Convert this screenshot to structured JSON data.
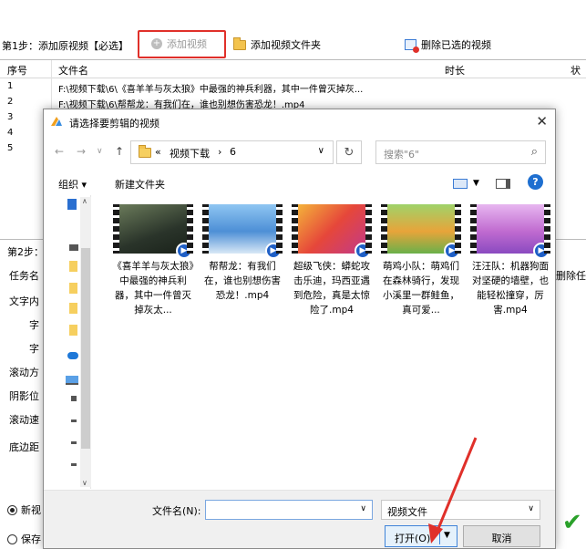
{
  "main": {
    "step1_label": "第1步：添加原视频【必选】",
    "toolbar": {
      "add_video": "添加视频",
      "add_folder": "添加视频文件夹",
      "delete_selected": "删除已选的视频"
    },
    "table": {
      "headers": [
        "序号",
        "文件名",
        "时长",
        "状"
      ],
      "rows": [
        {
          "n": "1",
          "file": "F:\\视频下载\\6\\《喜羊羊与灰太狼》中最强的神兵利器，其中一件曾灭掉灰..."
        },
        {
          "n": "2",
          "file": "F:\\视频下载\\6\\帮帮龙：有我们在，谁也别想伤害恐龙！.mp4"
        },
        {
          "n": "3",
          "file": ""
        },
        {
          "n": "4",
          "file": ""
        },
        {
          "n": "5",
          "file": ""
        }
      ]
    },
    "step2_label": "第2步：",
    "side_labels": [
      "任务名",
      "文字内",
      "字",
      "字",
      "滚动方",
      "阴影位",
      "滚动速",
      "底边距"
    ],
    "right_cut_label": "删除任",
    "radio_new": "新视",
    "radio_save": "保存"
  },
  "dialog": {
    "title": "请选择要剪辑的视频",
    "path": [
      "«",
      "视频下载",
      "›",
      "6"
    ],
    "search_placeholder": "搜索\"6\"",
    "organize": "组织 ▾",
    "new_folder": "新建文件夹",
    "files": [
      {
        "caption": "《喜羊羊与灰太狼》中最强的神兵利器，其中一件曾灭掉灰太...",
        "thumb": "#3a4a3a"
      },
      {
        "caption": "帮帮龙：有我们在，谁也别想伤害恐龙！.mp4",
        "thumb": "#4d8fd6"
      },
      {
        "caption": "超级飞侠：蟒蛇攻击乐迪，玛西亚遇到危险，真是太惊险了.mp4",
        "thumb": "#e6473a"
      },
      {
        "caption": "萌鸡小队：萌鸡们在森林骑行，发现小溪里一群鲑鱼，真可爱...",
        "thumb": "#e8a43a"
      },
      {
        "caption": "汪汪队：机器狗面对坚硬的墙壁，也能轻松撞穿，厉害.mp4",
        "thumb": "#c06bd0"
      }
    ],
    "filename_label": "文件名(N):",
    "filename_value": "",
    "filetype": "视频文件",
    "open": "打开(O)",
    "cancel": "取消"
  }
}
